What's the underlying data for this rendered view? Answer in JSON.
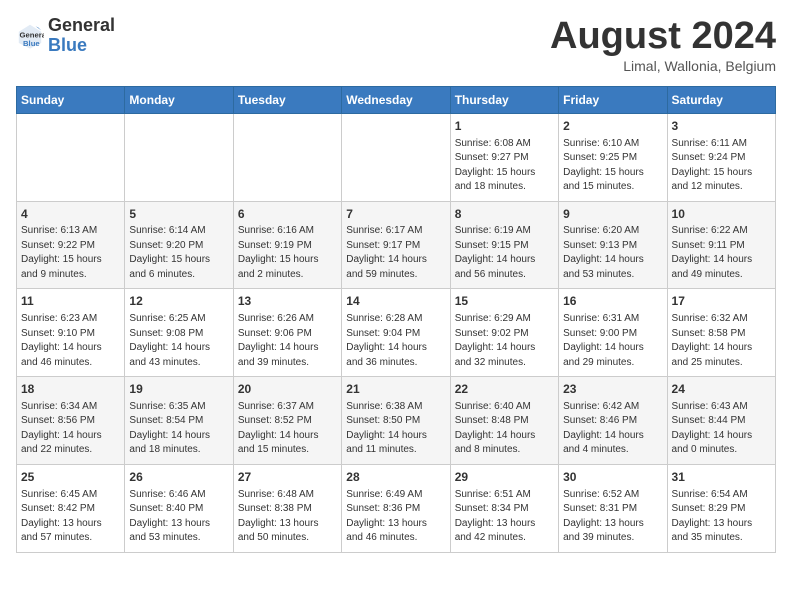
{
  "header": {
    "logo_general": "General",
    "logo_blue": "Blue",
    "month_year": "August 2024",
    "location": "Limal, Wallonia, Belgium"
  },
  "calendar": {
    "days_of_week": [
      "Sunday",
      "Monday",
      "Tuesday",
      "Wednesday",
      "Thursday",
      "Friday",
      "Saturday"
    ],
    "weeks": [
      {
        "cells": [
          {
            "day": "",
            "info": ""
          },
          {
            "day": "",
            "info": ""
          },
          {
            "day": "",
            "info": ""
          },
          {
            "day": "",
            "info": ""
          },
          {
            "day": "1",
            "info": "Sunrise: 6:08 AM\nSunset: 9:27 PM\nDaylight: 15 hours\nand 18 minutes."
          },
          {
            "day": "2",
            "info": "Sunrise: 6:10 AM\nSunset: 9:25 PM\nDaylight: 15 hours\nand 15 minutes."
          },
          {
            "day": "3",
            "info": "Sunrise: 6:11 AM\nSunset: 9:24 PM\nDaylight: 15 hours\nand 12 minutes."
          }
        ]
      },
      {
        "cells": [
          {
            "day": "4",
            "info": "Sunrise: 6:13 AM\nSunset: 9:22 PM\nDaylight: 15 hours\nand 9 minutes."
          },
          {
            "day": "5",
            "info": "Sunrise: 6:14 AM\nSunset: 9:20 PM\nDaylight: 15 hours\nand 6 minutes."
          },
          {
            "day": "6",
            "info": "Sunrise: 6:16 AM\nSunset: 9:19 PM\nDaylight: 15 hours\nand 2 minutes."
          },
          {
            "day": "7",
            "info": "Sunrise: 6:17 AM\nSunset: 9:17 PM\nDaylight: 14 hours\nand 59 minutes."
          },
          {
            "day": "8",
            "info": "Sunrise: 6:19 AM\nSunset: 9:15 PM\nDaylight: 14 hours\nand 56 minutes."
          },
          {
            "day": "9",
            "info": "Sunrise: 6:20 AM\nSunset: 9:13 PM\nDaylight: 14 hours\nand 53 minutes."
          },
          {
            "day": "10",
            "info": "Sunrise: 6:22 AM\nSunset: 9:11 PM\nDaylight: 14 hours\nand 49 minutes."
          }
        ]
      },
      {
        "cells": [
          {
            "day": "11",
            "info": "Sunrise: 6:23 AM\nSunset: 9:10 PM\nDaylight: 14 hours\nand 46 minutes."
          },
          {
            "day": "12",
            "info": "Sunrise: 6:25 AM\nSunset: 9:08 PM\nDaylight: 14 hours\nand 43 minutes."
          },
          {
            "day": "13",
            "info": "Sunrise: 6:26 AM\nSunset: 9:06 PM\nDaylight: 14 hours\nand 39 minutes."
          },
          {
            "day": "14",
            "info": "Sunrise: 6:28 AM\nSunset: 9:04 PM\nDaylight: 14 hours\nand 36 minutes."
          },
          {
            "day": "15",
            "info": "Sunrise: 6:29 AM\nSunset: 9:02 PM\nDaylight: 14 hours\nand 32 minutes."
          },
          {
            "day": "16",
            "info": "Sunrise: 6:31 AM\nSunset: 9:00 PM\nDaylight: 14 hours\nand 29 minutes."
          },
          {
            "day": "17",
            "info": "Sunrise: 6:32 AM\nSunset: 8:58 PM\nDaylight: 14 hours\nand 25 minutes."
          }
        ]
      },
      {
        "cells": [
          {
            "day": "18",
            "info": "Sunrise: 6:34 AM\nSunset: 8:56 PM\nDaylight: 14 hours\nand 22 minutes."
          },
          {
            "day": "19",
            "info": "Sunrise: 6:35 AM\nSunset: 8:54 PM\nDaylight: 14 hours\nand 18 minutes."
          },
          {
            "day": "20",
            "info": "Sunrise: 6:37 AM\nSunset: 8:52 PM\nDaylight: 14 hours\nand 15 minutes."
          },
          {
            "day": "21",
            "info": "Sunrise: 6:38 AM\nSunset: 8:50 PM\nDaylight: 14 hours\nand 11 minutes."
          },
          {
            "day": "22",
            "info": "Sunrise: 6:40 AM\nSunset: 8:48 PM\nDaylight: 14 hours\nand 8 minutes."
          },
          {
            "day": "23",
            "info": "Sunrise: 6:42 AM\nSunset: 8:46 PM\nDaylight: 14 hours\nand 4 minutes."
          },
          {
            "day": "24",
            "info": "Sunrise: 6:43 AM\nSunset: 8:44 PM\nDaylight: 14 hours\nand 0 minutes."
          }
        ]
      },
      {
        "cells": [
          {
            "day": "25",
            "info": "Sunrise: 6:45 AM\nSunset: 8:42 PM\nDaylight: 13 hours\nand 57 minutes."
          },
          {
            "day": "26",
            "info": "Sunrise: 6:46 AM\nSunset: 8:40 PM\nDaylight: 13 hours\nand 53 minutes."
          },
          {
            "day": "27",
            "info": "Sunrise: 6:48 AM\nSunset: 8:38 PM\nDaylight: 13 hours\nand 50 minutes."
          },
          {
            "day": "28",
            "info": "Sunrise: 6:49 AM\nSunset: 8:36 PM\nDaylight: 13 hours\nand 46 minutes."
          },
          {
            "day": "29",
            "info": "Sunrise: 6:51 AM\nSunset: 8:34 PM\nDaylight: 13 hours\nand 42 minutes."
          },
          {
            "day": "30",
            "info": "Sunrise: 6:52 AM\nSunset: 8:31 PM\nDaylight: 13 hours\nand 39 minutes."
          },
          {
            "day": "31",
            "info": "Sunrise: 6:54 AM\nSunset: 8:29 PM\nDaylight: 13 hours\nand 35 minutes."
          }
        ]
      }
    ]
  }
}
